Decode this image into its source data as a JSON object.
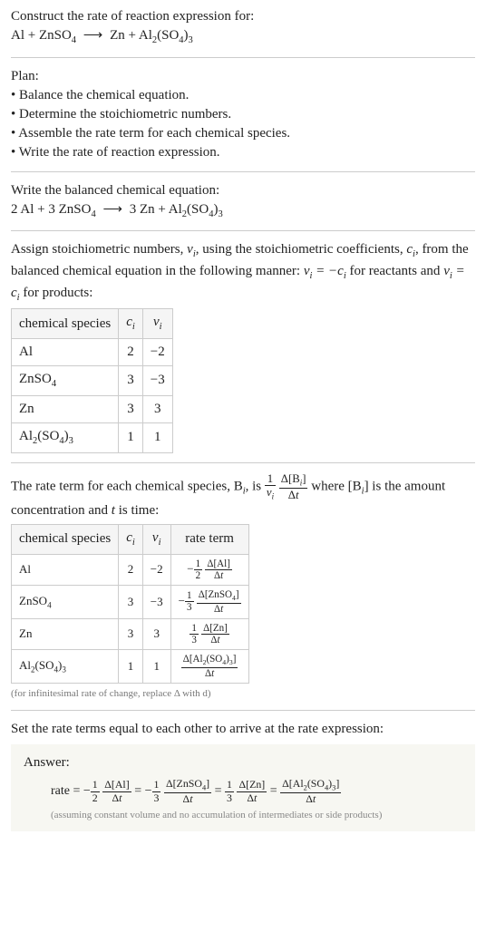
{
  "prompt": {
    "title": "Construct the rate of reaction expression for:",
    "equation": "Al + ZnSO₄ ⟶ Zn + Al₂(SO₄)₃"
  },
  "plan": {
    "title": "Plan:",
    "items": [
      "Balance the chemical equation.",
      "Determine the stoichiometric numbers.",
      "Assemble the rate term for each chemical species.",
      "Write the rate of reaction expression."
    ]
  },
  "balanced": {
    "title": "Write the balanced chemical equation:",
    "equation": "2 Al + 3 ZnSO₄ ⟶ 3 Zn + Al₂(SO₄)₃"
  },
  "stoich": {
    "intro_a": "Assign stoichiometric numbers, ",
    "intro_b": ", using the stoichiometric coefficients, ",
    "intro_c": ", from the balanced chemical equation in the following manner: ",
    "intro_d": " for reactants and ",
    "intro_e": " for products:",
    "nu_i": "νᵢ",
    "c_i": "cᵢ",
    "rel_react": "νᵢ = −cᵢ",
    "rel_prod": "νᵢ = cᵢ",
    "headers": [
      "chemical species",
      "cᵢ",
      "νᵢ"
    ],
    "rows": [
      {
        "species": "Al",
        "c": "2",
        "nu": "−2"
      },
      {
        "species": "ZnSO₄",
        "c": "3",
        "nu": "−3"
      },
      {
        "species": "Zn",
        "c": "3",
        "nu": "3"
      },
      {
        "species": "Al₂(SO₄)₃",
        "c": "1",
        "nu": "1"
      }
    ]
  },
  "rateterm": {
    "intro_a": "The rate term for each chemical species, B",
    "intro_b": ", is ",
    "intro_c": " where [B",
    "intro_d": "] is the amount concentration and ",
    "intro_e": " is time:",
    "t": "t",
    "i": "i",
    "headers": [
      "chemical species",
      "cᵢ",
      "νᵢ",
      "rate term"
    ],
    "rows": [
      {
        "species": "Al",
        "c": "2",
        "nu": "−2",
        "coef_num": "1",
        "coef_den": "2",
        "sign": "−",
        "delta": "Δ[Al]"
      },
      {
        "species": "ZnSO₄",
        "c": "3",
        "nu": "−3",
        "coef_num": "1",
        "coef_den": "3",
        "sign": "−",
        "delta": "Δ[ZnSO₄]"
      },
      {
        "species": "Zn",
        "c": "3",
        "nu": "3",
        "coef_num": "1",
        "coef_den": "3",
        "sign": "",
        "delta": "Δ[Zn]"
      },
      {
        "species": "Al₂(SO₄)₃",
        "c": "1",
        "nu": "1",
        "coef_num": "",
        "coef_den": "",
        "sign": "",
        "delta": "Δ[Al₂(SO₄)₃]"
      }
    ],
    "note": "(for infinitesimal rate of change, replace Δ with d)"
  },
  "final": {
    "title": "Set the rate terms equal to each other to arrive at the rate expression:"
  },
  "answer": {
    "label": "Answer:",
    "rate_label": "rate = ",
    "note": "(assuming constant volume and no accumulation of intermediates or side products)"
  }
}
